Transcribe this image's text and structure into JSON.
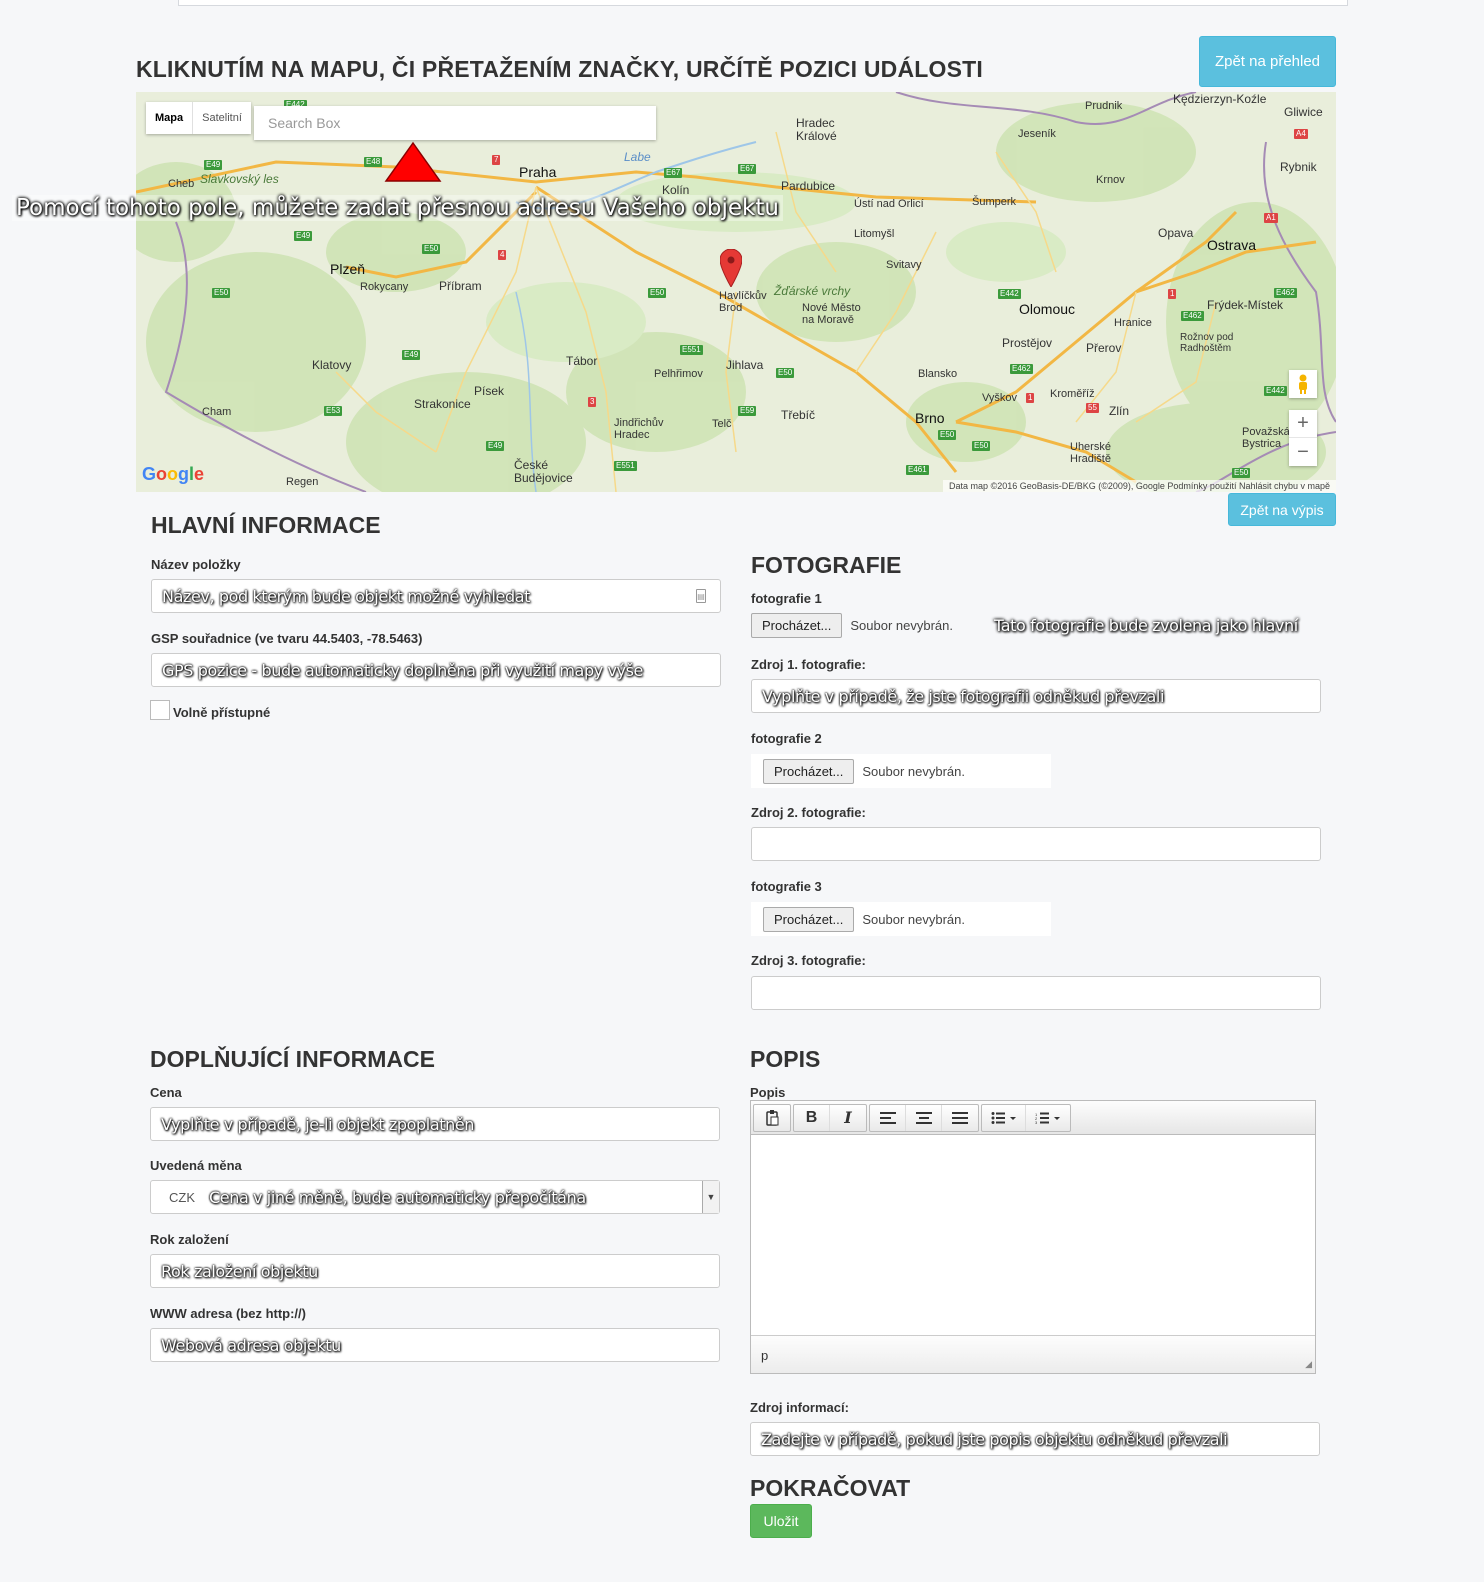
{
  "header": {
    "map_title": "KLIKNUTÍM NA MAPU, ČI PŘETAŽENÍM ZNAČKY, URČÍTĚ POZICI UDÁLOSTI",
    "back_overview": "Zpět na přehled",
    "back_list": "Zpět na výpis"
  },
  "map": {
    "type_map": "Mapa",
    "type_satellite": "Satelitní",
    "search_placeholder": "Search Box",
    "tip_overlay": "Pomocí tohoto pole, můžete zadat přesnou adresu Vašeho objektu",
    "google": "Google",
    "footer": "Data map ©2016 GeoBasis-DE/BKG (©2009), Google    Podmínky použití    Nahlásit chybu v mapě",
    "zoom_in": "+",
    "zoom_out": "−",
    "labels": {
      "praha": "Praha",
      "plzen": "Plzeň",
      "brno": "Brno",
      "ostrava": "Ostrava",
      "olomouc": "Olomouc",
      "pardubice": "Pardubice",
      "hradec": "Hradec Králové",
      "jihlava": "Jihlava",
      "tabor": "Tábor",
      "pisek": "Písek",
      "budejovice": "České Budějovice",
      "zlin": "Zlín",
      "havlickuv": "Havlíčkův Brod",
      "kolin": "Kolín",
      "pribram": "Příbram",
      "klatovy": "Klatovy",
      "opava": "Opava",
      "prerov": "Přerov",
      "frydek": "Frýdek-Místek",
      "kromeriz": "Kroměříž",
      "trebic": "Třebíč",
      "rokycany": "Rokycany",
      "strakonice": "Strakonice",
      "svitavy": "Svitavy",
      "sumperk": "Šumperk",
      "jesenik": "Jeseník",
      "prudnik": "Prudnik",
      "kedzierzyn": "Kędzierzyn-Koźle",
      "gliwice": "Gliwice",
      "rybnik": "Rybnik",
      "krnov": "Krnov",
      "cheb": "Cheb",
      "zdar": "Žďárské vrchy",
      "labe": "Labe",
      "prostejov": "Prostějov",
      "vyskov": "Vyškov",
      "blansko": "Blansko",
      "hranice": "Hranice",
      "litomysl": "Litomyšl",
      "pelhrimov": "Pelhřimov",
      "jindrichuv": "Jindřichův Hradec",
      "cham": "Cham",
      "regen": "Regen",
      "slavkovsky": "Slavkovský les",
      "uherske": "Uherské Hradiště",
      "novemesto": "Nové Město na Moravě",
      "usti": "Ústí nad Orlicí",
      "telc": "Telč",
      "roznov": "Rožnov pod Radhoštěm",
      "povazska": "Považská Bystrica"
    }
  },
  "main_info": {
    "heading": "HLAVNÍ INFORMACE",
    "name_label": "Název položky",
    "name_value": "Název, pod kterým bude objekt možné vyhledat",
    "gps_label": "GSP souřadnice (ve tvaru 44.5403, -78.5463)",
    "gps_value": "GPS pozice - bude automaticky doplněna při využití mapy výše",
    "free_label": "Volně přístupné"
  },
  "photos": {
    "heading": "FOTOGRAFIE",
    "browse": "Procházet...",
    "no_file": "Soubor nevybrán.",
    "photo1_label": "fotografie 1",
    "photo1_note": "Tato fotografie bude zvolena jako hlavní",
    "source1_label": "Zdroj 1. fotografie:",
    "source1_value": "Vyplňte v případě, že jste fotografii odněkud převzali",
    "photo2_label": "fotografie 2",
    "source2_label": "Zdroj 2. fotografie:",
    "photo3_label": "fotografie 3",
    "source3_label": "Zdroj 3. fotografie:"
  },
  "extra_info": {
    "heading": "DOPLŇUJÍCÍ INFORMACE",
    "price_label": "Cena",
    "price_value": "Vyplňte v případě, je-li objekt zpoplatněn",
    "currency_label": "Uvedená měna",
    "currency_selected": "CZK",
    "currency_note": "Cena v jiné měně, bude automaticky přepočítána",
    "year_label": "Rok založení",
    "year_value": "Rok založení objektu",
    "web_label": "WWW adresa (bez http://)",
    "web_value": "Webová adresa objektu"
  },
  "description": {
    "heading": "POPIS",
    "label": "Popis",
    "status_path": "p",
    "source_label": "Zdroj informací:",
    "source_value": "Zadejte v případě, pokud jste popis objektu odněkud převzali"
  },
  "continue": {
    "heading": "POKRAČOVAT",
    "save": "Uložit"
  },
  "colors": {
    "info": "#5bc0de",
    "success": "#5cb85c",
    "marker": "#e53935",
    "warning_triangle": "#ff0000"
  }
}
